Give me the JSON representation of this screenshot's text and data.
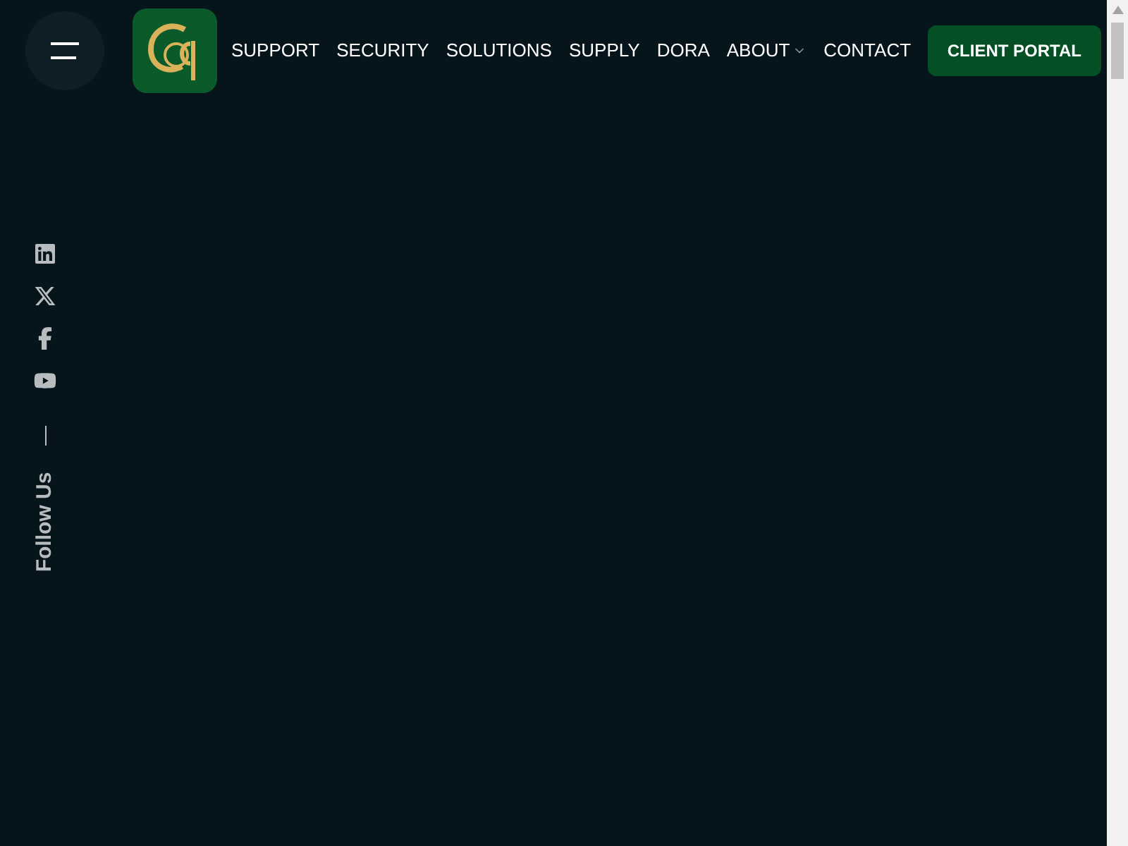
{
  "header": {
    "nav": [
      {
        "label": "SUPPORT",
        "kind": "link"
      },
      {
        "label": "SECURITY",
        "kind": "link"
      },
      {
        "label": "SOLUTIONS",
        "kind": "link"
      },
      {
        "label": "SUPPLY",
        "kind": "link"
      },
      {
        "label": "DORA",
        "kind": "link"
      },
      {
        "label": "ABOUT",
        "kind": "dropdown"
      },
      {
        "label": "CONTACT",
        "kind": "link"
      }
    ],
    "button": "CLIENT PORTAL"
  },
  "social": {
    "label": "Follow Us"
  }
}
